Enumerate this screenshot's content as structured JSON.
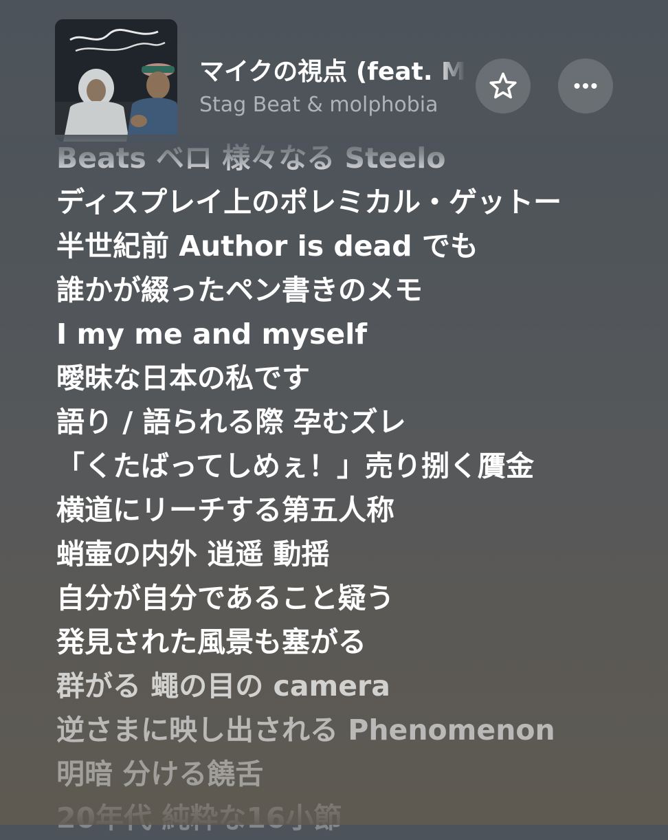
{
  "now_playing": {
    "title": "マイクの視点 (feat. MA",
    "artist": "Stag Beat & molphobia",
    "artwork_icon": "album-artwork",
    "favorite_icon": "star-outline-icon",
    "more_icon": "ellipsis-icon"
  },
  "lyrics": [
    "Beats ベロ 様々なる Steelo",
    "ディスプレイ上のポレミカル・ゲットー",
    "半世紀前 Author is dead でも",
    "誰かが綴ったペン書きのメモ",
    "I my me and myself",
    "曖昧な日本の私です",
    "語り / 語られる際 孕むズレ",
    "「くたばってしめぇ！」売り捌く贋金",
    "横道にリーチする第五人称",
    "蛸壷の内外 逍遥 動揺",
    "自分が自分であること疑う",
    "発見された風景も塞がる",
    "群がる 蠅の目の camera",
    "逆さまに映し出される Phenomenon",
    "明暗 分ける饒舌",
    "20年代 純粋な16小節"
  ],
  "colors": {
    "background_top": "#4c535a",
    "background_bottom": "#5e5a52",
    "lyric_active": "#ffffff"
  }
}
